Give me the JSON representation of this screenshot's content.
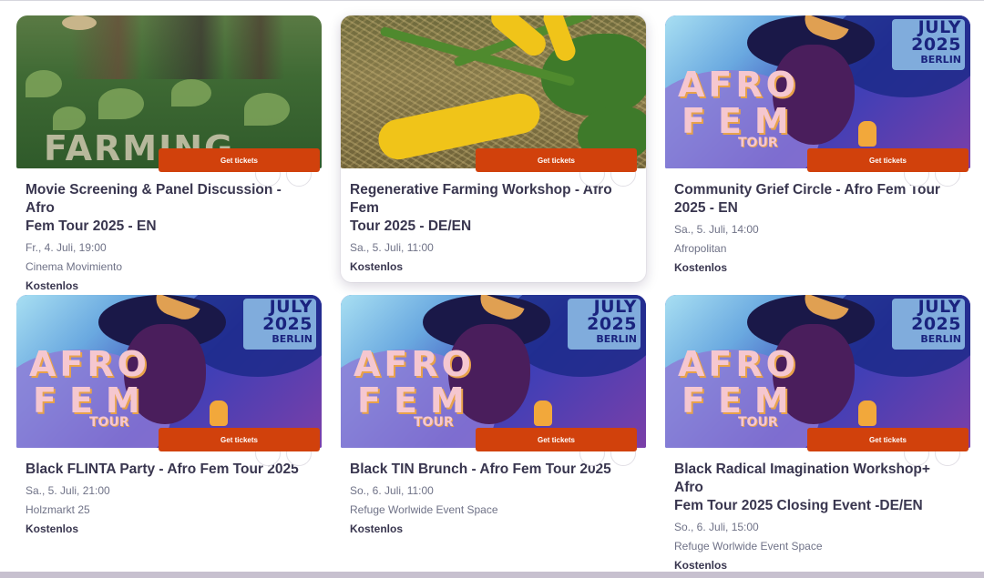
{
  "events": [
    {
      "id": "e1",
      "image": "farming-the-black-photo",
      "image_text": "FARMING THE BLACK",
      "button": "Get tickets",
      "title_lines": [
        "Movie Screening & Panel Discussion - Afro",
        "Fem Tour 2025 - EN"
      ],
      "date": "Fr., 4. Juli, 19:00",
      "venue": "Cinema Movimiento",
      "price": "Kostenlos"
    },
    {
      "id": "e2",
      "image": "zucchini-photo",
      "button": "Get tickets",
      "title_lines": [
        "Regenerative Farming Workshop - Afro Fem",
        "Tour 2025 - DE/EN"
      ],
      "date": "Sa., 5. Juli, 11:00",
      "venue": "",
      "price": "Kostenlos"
    },
    {
      "id": "e3",
      "image": "afro-fem-tour-poster",
      "button": "Get tickets",
      "title_lines": [
        "Community Grief Circle - Afro Fem Tour",
        "2025 - EN"
      ],
      "date": "Sa., 5. Juli, 14:00",
      "venue": "Afropolitan",
      "price": "Kostenlos"
    },
    {
      "id": "e4",
      "image": "afro-fem-tour-poster",
      "button": "Get tickets",
      "title_lines": [
        "Black FLINTA Party - Afro Fem Tour 2025"
      ],
      "date": "Sa., 5. Juli, 21:00",
      "venue": "Holzmarkt 25",
      "price": "Kostenlos"
    },
    {
      "id": "e5",
      "image": "afro-fem-tour-poster",
      "button": "Get tickets",
      "title_lines": [
        "Black TIN Brunch - Afro Fem Tour 2025"
      ],
      "date": "So., 6. Juli, 11:00",
      "venue": "Refuge Worlwide Event Space",
      "price": "Kostenlos"
    },
    {
      "id": "e6",
      "image": "afro-fem-tour-poster",
      "button": "Get tickets",
      "title_lines": [
        "Black Radical Imagination Workshop+ Afro",
        "Fem Tour 2025 Closing Event -DE/EN"
      ],
      "date": "So., 6. Juli, 15:00",
      "venue": "Refuge Worlwide Event Space",
      "price": "Kostenlos"
    }
  ],
  "poster": {
    "month": "JULY",
    "year": "2025",
    "city": "BERLIN",
    "word1": "AFRO",
    "word2": "FEM",
    "word3": "TOUR"
  },
  "colors": {
    "button": "#d1410c",
    "title": "#39364f",
    "meta": "#6f7287"
  }
}
